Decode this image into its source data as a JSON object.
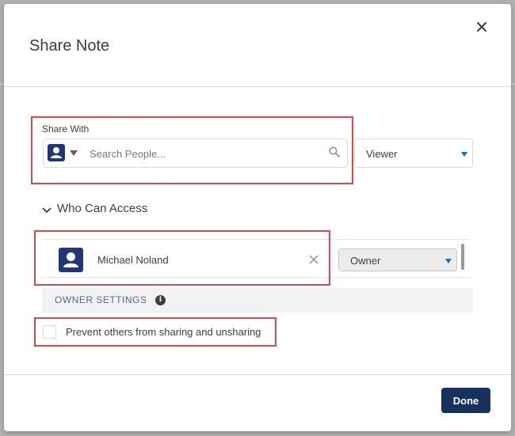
{
  "modal": {
    "title": "Share Note",
    "close_icon": "close-icon"
  },
  "share_with": {
    "label": "Share With",
    "avatar_icon": "user-icon",
    "search_placeholder": "Search People...",
    "search_icon": "search-icon",
    "permission": "Viewer"
  },
  "access": {
    "toggle_label": "Who Can Access",
    "users": [
      {
        "name": "Michael Noland",
        "role": "Owner"
      }
    ]
  },
  "owner_settings": {
    "header": "OWNER SETTINGS",
    "info_icon": "info-icon",
    "checkbox_label": "Prevent others from sharing and unsharing",
    "checked": false
  },
  "footer": {
    "done_label": "Done"
  },
  "colors": {
    "brand_navy": "#16325c",
    "avatar_blue": "#21367a",
    "accent_blue": "#0070d2",
    "highlight_red": "#e0474c"
  }
}
